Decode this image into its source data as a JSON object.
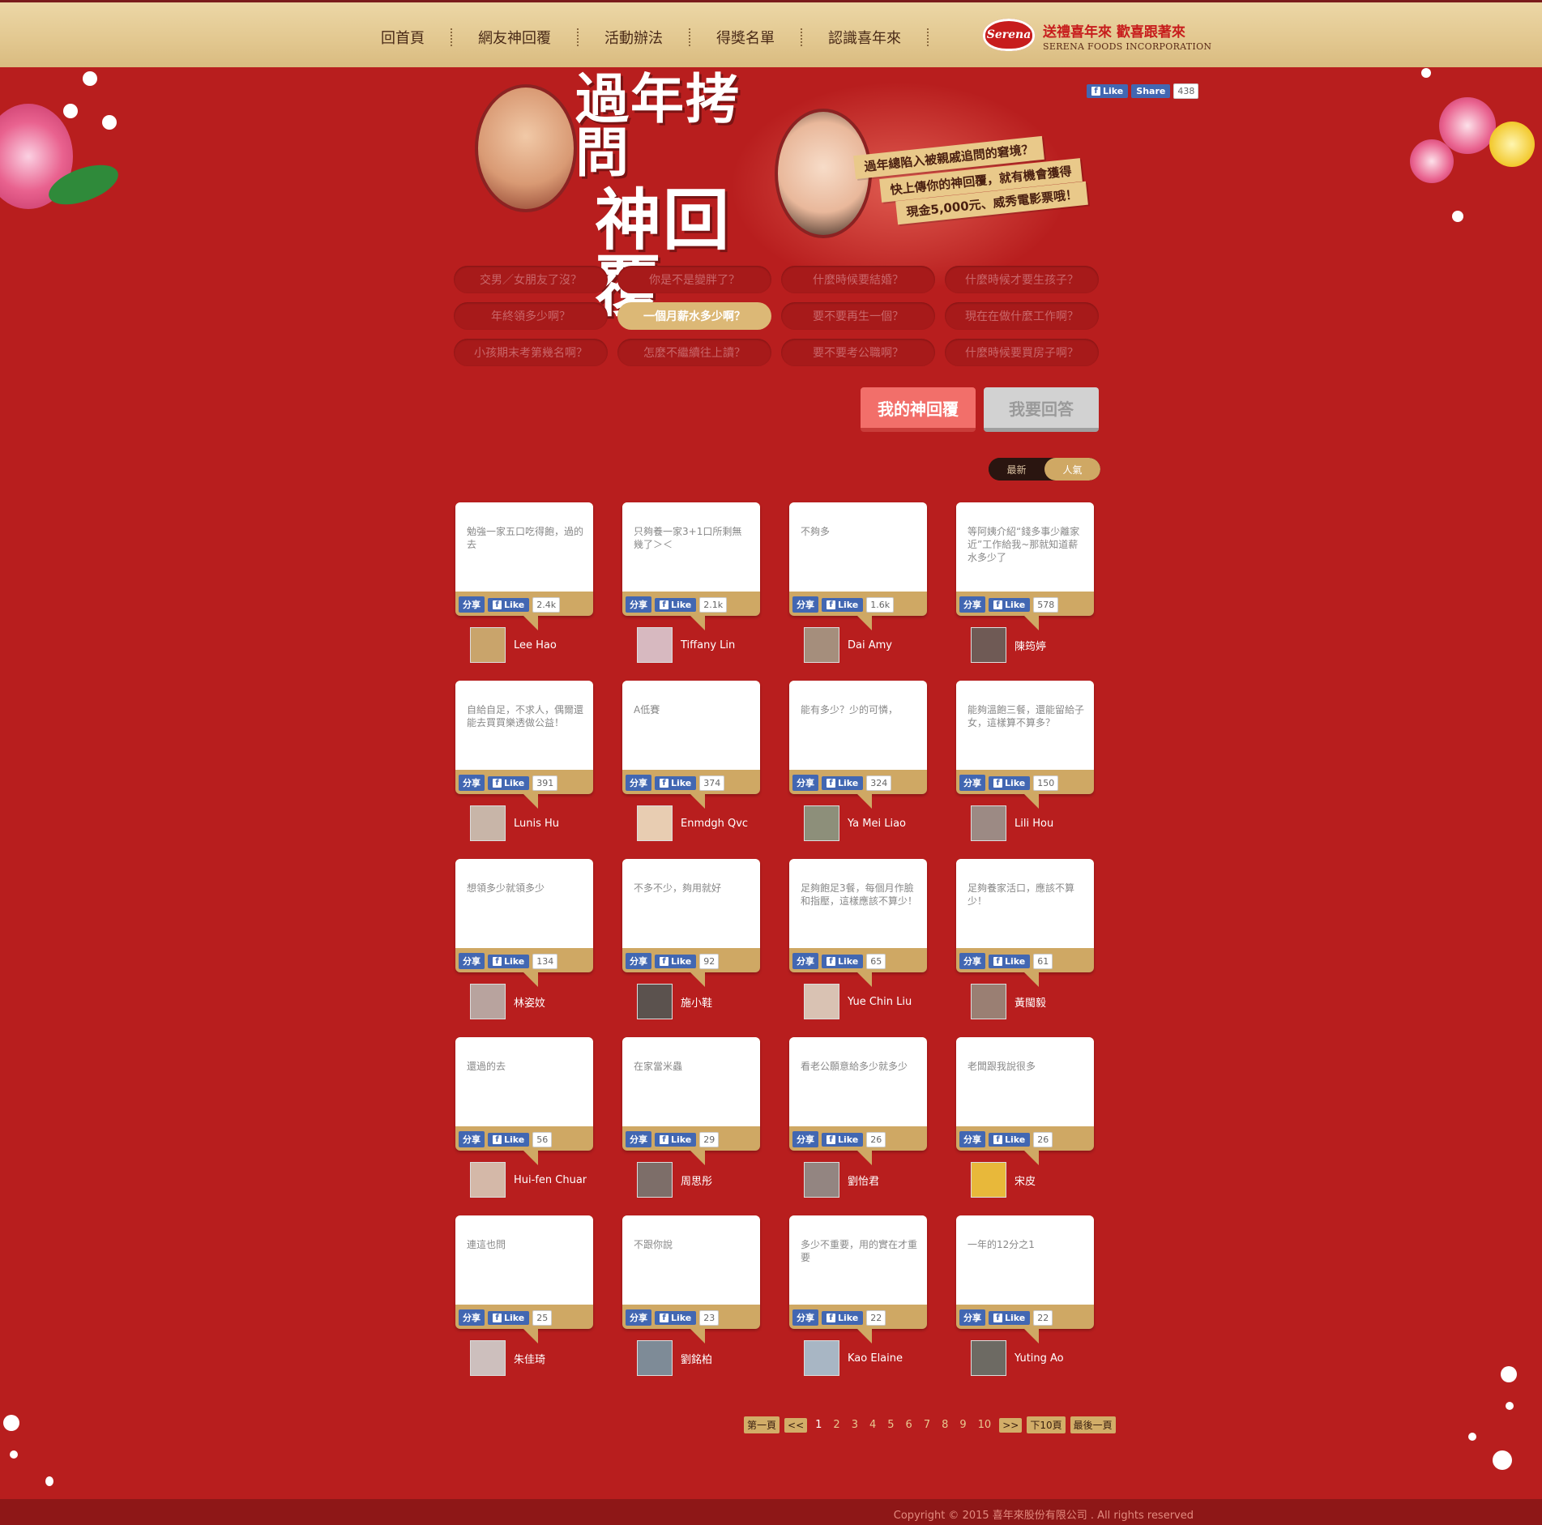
{
  "nav": {
    "items": [
      "回首頁",
      "網友神回覆",
      "活動辦法",
      "得獎名單",
      "認識喜年來"
    ]
  },
  "logo": {
    "badge": "Serena",
    "slogan": "送禮喜年來 歡喜跟著來",
    "english": "SERENA FOODS INCORPORATION"
  },
  "hero": {
    "title_line1": "過年拷問",
    "title_line2": "神回覆",
    "notes": [
      "過年總陷入被親戚追問的窘境？",
      "快上傳你的神回覆，就有機會獲得",
      "現金5,000元、威秀電影票哦！"
    ]
  },
  "fb_top": {
    "like": "Like",
    "share": "Share",
    "count": "438"
  },
  "tags": [
    "交男／女朋友了沒？",
    "你是不是變胖了？",
    "什麼時候要結婚？",
    "什麼時候才要生孩子？",
    "年終領多少啊？",
    "一個月薪水多少啊？",
    "要不要再生一個？",
    "現在在做什麼工作啊？",
    "小孩期末考第幾名啊？",
    "怎麼不繼續往上讀？",
    "要不要考公職啊？",
    "什麼時候要買房子啊？"
  ],
  "active_tag_index": 5,
  "modes": {
    "my_reply": "我的神回覆",
    "answer": "我要回答"
  },
  "sort": {
    "newest": "最新",
    "popular": "人氣"
  },
  "card_labels": {
    "share": "分享",
    "like": "Like"
  },
  "cards": [
    {
      "text": "勉強一家五口吃得飽，過的去",
      "likes": "2.4k",
      "user": "Lee Hao",
      "avatar": "#c9a46b"
    },
    {
      "text": "只夠養一家3+1口所剩無幾了＞＜",
      "likes": "2.1k",
      "user": "Tiffany Lin",
      "avatar": "#d7b9c0"
    },
    {
      "text": "不夠多",
      "likes": "1.6k",
      "user": "Dai Amy",
      "avatar": "#a58e7c"
    },
    {
      "text": "等阿姨介紹“錢多事少離家近”工作給我~那就知道薪水多少了",
      "likes": "578",
      "user": "陳筠婷",
      "avatar": "#6f5a55"
    },
    {
      "text": "自給自足，不求人，偶爾還能去買買樂透做公益！",
      "likes": "391",
      "user": "Lunis Hu",
      "avatar": "#c8b5a8"
    },
    {
      "text": "A低賽",
      "likes": "374",
      "user": "Enmdgh Qvc",
      "avatar": "#e8cdb2"
    },
    {
      "text": "能有多少？少的可憐，",
      "likes": "324",
      "user": "Ya Mei Liao",
      "avatar": "#8d8f7a"
    },
    {
      "text": "能夠溫飽三餐，還能留給子女，這樣算不算多？",
      "likes": "150",
      "user": "Lili Hou",
      "avatar": "#9c8a84"
    },
    {
      "text": "想領多少就領多少",
      "likes": "134",
      "user": "林姿妏",
      "avatar": "#b8a39e"
    },
    {
      "text": "不多不少，夠用就好",
      "likes": "92",
      "user": "施小鞋",
      "avatar": "#5b524e"
    },
    {
      "text": "足夠飽足3餐，每個月作臉和指壓，這樣應該不算少！",
      "likes": "65",
      "user": "Yue Chin Liu",
      "avatar": "#d9c2b3"
    },
    {
      "text": "足夠養家活口，應該不算少！",
      "likes": "61",
      "user": "黃閩毅",
      "avatar": "#9a7f73"
    },
    {
      "text": "還過的去",
      "likes": "56",
      "user": "Hui-fen Chuang",
      "avatar": "#d4b8a8"
    },
    {
      "text": "在家當米蟲",
      "likes": "29",
      "user": "周思彤",
      "avatar": "#7d6e69"
    },
    {
      "text": "看老公願意給多少就多少",
      "likes": "26",
      "user": "劉怡君",
      "avatar": "#938581"
    },
    {
      "text": "老闆跟我說很多",
      "likes": "26",
      "user": "宋皮",
      "avatar": "#e8b83a"
    },
    {
      "text": "連這也問",
      "likes": "25",
      "user": "朱佳琦",
      "avatar": "#cdbfbd"
    },
    {
      "text": "不跟你說",
      "likes": "23",
      "user": "劉銘柏",
      "avatar": "#7e8b97"
    },
    {
      "text": "多少不重要，用的實在才重要",
      "likes": "22",
      "user": "Kao Elaine",
      "avatar": "#a8b6c4"
    },
    {
      "text": "一年的12分之1",
      "likes": "22",
      "user": "Yuting Ao",
      "avatar": "#6d6a63"
    }
  ],
  "pager": {
    "first": "第一頁",
    "prev": "<<",
    "pages": [
      "1",
      "2",
      "3",
      "4",
      "5",
      "6",
      "7",
      "8",
      "9",
      "10"
    ],
    "next": ">>",
    "next10": "下10頁",
    "last": "最後一頁",
    "current": "1"
  },
  "footer": {
    "copyright": "Copyright © 2015 喜年來股份有限公司 . All rights reserved"
  },
  "colors": {
    "bg": "#b81e1e",
    "gold": "#cfa864",
    "fb": "#4267b2",
    "active_btn": "#f26f6a"
  }
}
